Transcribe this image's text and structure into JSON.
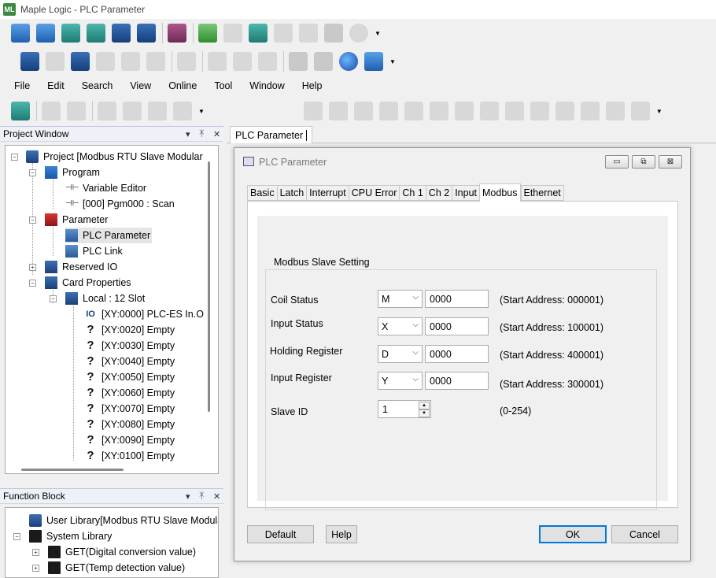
{
  "window": {
    "title": "Maple Logic - PLC Parameter",
    "app_icon": "ML"
  },
  "menu": [
    "File",
    "Edit",
    "Search",
    "View",
    "Online",
    "Tool",
    "Window",
    "Help"
  ],
  "project_window": {
    "title": "Project Window",
    "controls": {
      "dropdown": "▾",
      "pin": "ᛡ",
      "close": "✕"
    },
    "nodes": [
      {
        "label": "Project [Modbus RTU Slave Modular",
        "icon": "project-icon"
      },
      {
        "label": "Program",
        "icon": "program-icon"
      },
      {
        "label": "Variable Editor",
        "icon": "variable-editor-icon"
      },
      {
        "label": "[000] Pgm000 : Scan",
        "icon": "ladder-icon"
      },
      {
        "label": "Parameter",
        "icon": "parameter-icon"
      },
      {
        "label": "PLC Parameter",
        "icon": "plc-parameter-icon"
      },
      {
        "label": "PLC Link",
        "icon": "plc-link-icon"
      },
      {
        "label": "Reserved IO",
        "icon": "reserved-io-icon"
      },
      {
        "label": "Card Properties",
        "icon": "card-properties-icon"
      },
      {
        "label": "Local : 12 Slot",
        "icon": "local-slot-icon"
      },
      {
        "label": "[XY:0000] PLC-ES In.O",
        "icon": "io-card-icon"
      },
      {
        "label": "[XY:0020] Empty",
        "icon": "question-icon"
      },
      {
        "label": "[XY:0030] Empty",
        "icon": "question-icon"
      },
      {
        "label": "[XY:0040] Empty",
        "icon": "question-icon"
      },
      {
        "label": "[XY:0050] Empty",
        "icon": "question-icon"
      },
      {
        "label": "[XY:0060] Empty",
        "icon": "question-icon"
      },
      {
        "label": "[XY:0070] Empty",
        "icon": "question-icon"
      },
      {
        "label": "[XY:0080] Empty",
        "icon": "question-icon"
      },
      {
        "label": "[XY:0090] Empty",
        "icon": "question-icon"
      },
      {
        "label": "[XY:0100] Empty",
        "icon": "question-icon"
      }
    ]
  },
  "function_block": {
    "title": "Function Block",
    "nodes": [
      {
        "label": "User Library[Modbus RTU Slave Modula",
        "icon": "user-library-icon"
      },
      {
        "label": "System Library",
        "icon": "system-library-icon"
      },
      {
        "label": "GET(Digital conversion value)",
        "icon": "function-block-icon"
      },
      {
        "label": "GET(Temp detection value)",
        "icon": "function-block-icon"
      }
    ]
  },
  "doc_tab": {
    "label": "PLC Parameter"
  },
  "dialog": {
    "title": "PLC Parameter",
    "window_buttons": {
      "minimize": "▭",
      "restore": "⧉",
      "close": "⊠"
    },
    "tabs": [
      "Basic",
      "Latch",
      "Interrupt",
      "CPU Error",
      "Ch 1",
      "Ch 2",
      "Input",
      "Modbus",
      "Ethernet"
    ],
    "active_tab": "Modbus",
    "group_label": "Modbus Slave Setting",
    "rows": [
      {
        "label": "Coil Status",
        "device": "M",
        "address": "0000",
        "start": "(Start Address: 000001)"
      },
      {
        "label": "Input Status",
        "device": "X",
        "address": "0000",
        "start": "(Start Address: 100001)"
      },
      {
        "label": "Holding Register",
        "device": "D",
        "address": "0000",
        "start": "(Start Address: 400001)"
      },
      {
        "label": "Input Register",
        "device": "Y",
        "address": "0000",
        "start": "(Start Address: 300001)"
      }
    ],
    "slave_id": {
      "label": "Slave ID",
      "value": "1",
      "range": "(0-254)"
    },
    "buttons": {
      "default": "Default",
      "help": "Help",
      "ok": "OK",
      "cancel": "Cancel"
    }
  }
}
